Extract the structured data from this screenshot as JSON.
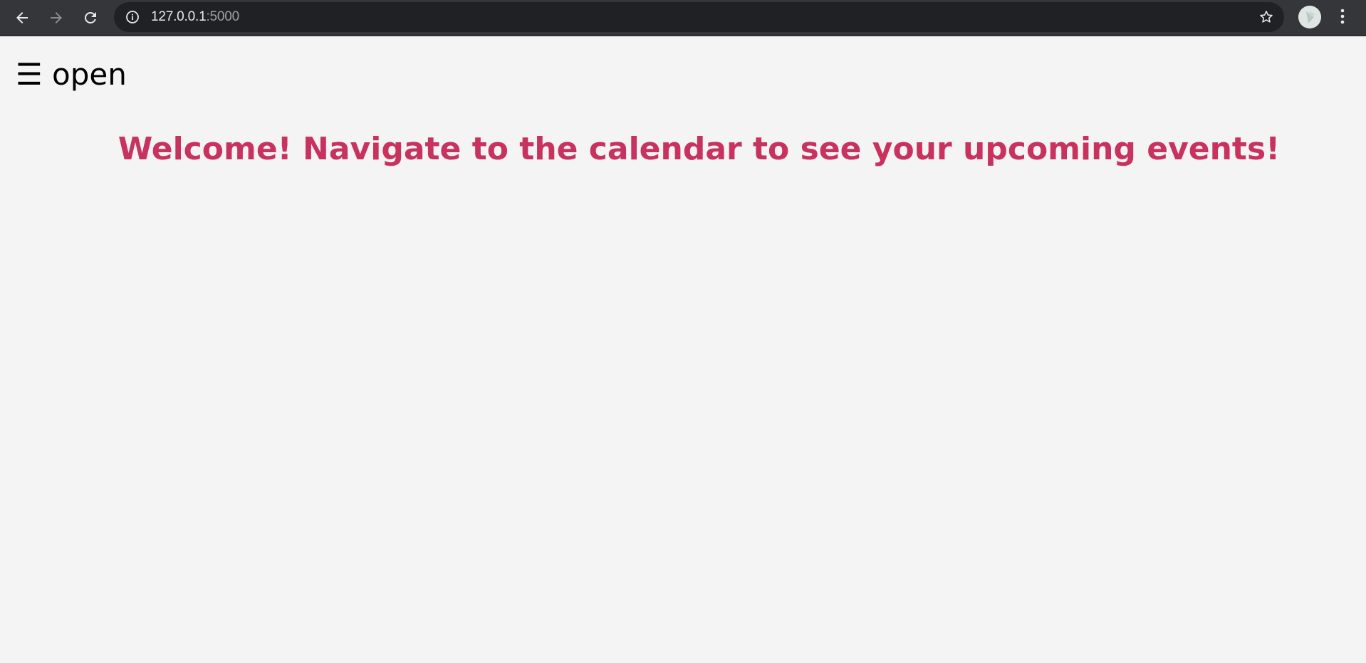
{
  "browser": {
    "url_host": "127.0.0.1",
    "url_port": ":5000",
    "icons": {
      "back": "back-arrow-icon",
      "forward": "forward-arrow-icon",
      "reload": "reload-icon",
      "info": "info-icon",
      "bookmark": "star-icon",
      "menu": "vertical-dots-icon"
    }
  },
  "page": {
    "menu_toggle_label": "☰ open",
    "welcome_message": "Welcome! Navigate to the calendar to see your upcoming events!"
  },
  "colors": {
    "toolbar_bg": "#35363a",
    "omnibox_bg": "#202124",
    "page_bg": "#f4f4f4",
    "welcome_text": "#c8325f"
  }
}
